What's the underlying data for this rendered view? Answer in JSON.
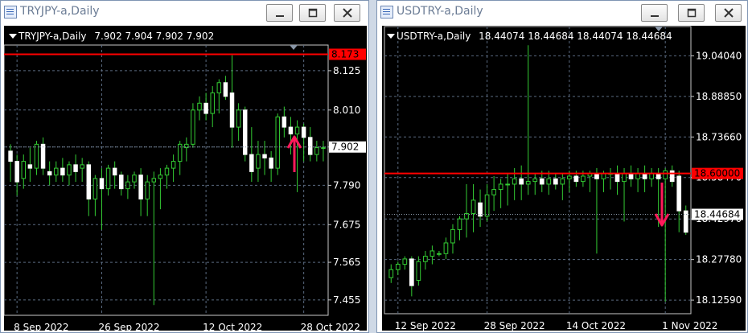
{
  "windows": [
    {
      "id": "left",
      "title": "TRYJPY-a,Daily",
      "header": {
        "symbol": "TRYJPY-a,Daily",
        "ohlc": "7.902 7.904 7.902 7.902"
      },
      "y_ticks": [
        "8.125",
        "8.010",
        "7.902",
        "7.790",
        "7.675",
        "7.565",
        "7.455"
      ],
      "y_tick_values": [
        8.125,
        8.01,
        7.902,
        7.79,
        7.675,
        7.565,
        7.455
      ],
      "x_ticks": [
        "8 Sep 2022",
        "26 Sep 2022",
        "12 Oct 2022",
        "28 Oct 2022"
      ],
      "h_line": {
        "label": "8.173",
        "value": 8.173,
        "color": "#ff0000"
      },
      "price_marker": {
        "label": "7.902",
        "value": 7.902
      },
      "arrow": {
        "direction": "up",
        "color": "#ff1a5a"
      }
    },
    {
      "id": "right",
      "title": "USDTRY-a,Daily",
      "header": {
        "symbol": "USDTRY-a,Daily",
        "ohlc": "18.44074 18.44684 18.44074 18.44684"
      },
      "y_ticks": [
        "19.04040",
        "18.88850",
        "18.73660",
        "18.58470",
        "18.42970",
        "18.27780",
        "18.12590"
      ],
      "y_tick_values": [
        19.0404,
        18.8885,
        18.7366,
        18.5847,
        18.4297,
        18.2778,
        18.1259
      ],
      "x_ticks": [
        "12 Sep 2022",
        "28 Sep 2022",
        "14 Oct 2022",
        "1 Nov 2022"
      ],
      "h_line": {
        "label": "18.60000",
        "value": 18.6,
        "color": "#ff0000"
      },
      "price_marker": {
        "label": "18.44684",
        "value": 18.44684
      },
      "arrow": {
        "direction": "down",
        "color": "#ff1a5a"
      }
    }
  ],
  "chart_data": [
    {
      "type": "candlestick",
      "title": "TRYJPY-a,Daily",
      "x": [
        "8 Sep 2022",
        "26 Sep 2022",
        "12 Oct 2022",
        "28 Oct 2022"
      ],
      "ylim": [
        7.41,
        8.2
      ],
      "candles": [
        [
          7.89,
          7.91,
          7.8,
          7.86
        ],
        [
          7.86,
          7.88,
          7.76,
          7.8
        ],
        [
          7.81,
          7.88,
          7.78,
          7.86
        ],
        [
          7.85,
          7.9,
          7.8,
          7.84
        ],
        [
          7.84,
          7.92,
          7.82,
          7.91
        ],
        [
          7.91,
          7.93,
          7.82,
          7.84
        ],
        [
          7.83,
          7.86,
          7.79,
          7.82
        ],
        [
          7.82,
          7.86,
          7.8,
          7.84
        ],
        [
          7.84,
          7.87,
          7.8,
          7.82
        ],
        [
          7.82,
          7.86,
          7.79,
          7.85
        ],
        [
          7.85,
          7.88,
          7.8,
          7.83
        ],
        [
          7.84,
          7.87,
          7.8,
          7.85
        ],
        [
          7.85,
          7.86,
          7.7,
          7.75
        ],
        [
          7.75,
          7.82,
          7.7,
          7.81
        ],
        [
          7.81,
          7.84,
          7.66,
          7.78
        ],
        [
          7.78,
          7.85,
          7.76,
          7.84
        ],
        [
          7.84,
          7.86,
          7.78,
          7.82
        ],
        [
          7.82,
          7.83,
          7.76,
          7.78
        ],
        [
          7.78,
          7.82,
          7.75,
          7.8
        ],
        [
          7.8,
          7.83,
          7.78,
          7.82
        ],
        [
          7.82,
          7.84,
          7.7,
          7.75
        ],
        [
          7.75,
          7.82,
          7.7,
          7.8
        ],
        [
          7.8,
          7.83,
          7.44,
          7.81
        ],
        [
          7.81,
          7.84,
          7.72,
          7.82
        ],
        [
          7.82,
          7.85,
          7.78,
          7.84
        ],
        [
          7.84,
          7.88,
          7.8,
          7.86
        ],
        [
          7.86,
          7.92,
          7.82,
          7.91
        ],
        [
          7.9,
          7.93,
          7.86,
          7.91
        ],
        [
          7.91,
          8.03,
          7.9,
          8.01
        ],
        [
          8.01,
          8.05,
          7.98,
          8.03
        ],
        [
          8.03,
          8.06,
          7.98,
          8.0
        ],
        [
          8.0,
          8.08,
          7.96,
          8.06
        ],
        [
          8.06,
          8.1,
          8.0,
          8.09
        ],
        [
          8.09,
          8.11,
          8.04,
          8.05
        ],
        [
          8.06,
          8.17,
          7.9,
          7.96
        ],
        [
          7.96,
          8.03,
          7.92,
          8.01
        ],
        [
          8.01,
          8.02,
          7.86,
          7.88
        ],
        [
          7.88,
          7.96,
          7.8,
          7.83
        ],
        [
          7.84,
          7.92,
          7.8,
          7.88
        ],
        [
          7.88,
          7.92,
          7.82,
          7.87
        ],
        [
          7.87,
          7.89,
          7.8,
          7.84
        ],
        [
          7.84,
          8.0,
          7.82,
          7.99
        ],
        [
          7.99,
          8.02,
          7.93,
          7.96
        ],
        [
          7.96,
          7.99,
          7.88,
          7.94
        ],
        [
          7.94,
          7.98,
          7.77,
          7.96
        ],
        [
          7.96,
          7.97,
          7.86,
          7.93
        ],
        [
          7.93,
          7.96,
          7.86,
          7.88
        ],
        [
          7.88,
          7.92,
          7.86,
          7.9
        ],
        [
          7.9,
          7.92,
          7.86,
          7.9
        ]
      ]
    },
    {
      "type": "candlestick",
      "title": "USDTRY-a,Daily",
      "x": [
        "12 Sep 2022",
        "28 Sep 2022",
        "14 Oct 2022",
        "1 Nov 2022"
      ],
      "ylim": [
        18.075,
        19.15
      ],
      "candles": [
        [
          18.21,
          18.26,
          18.19,
          18.24
        ],
        [
          18.24,
          18.27,
          18.22,
          18.26
        ],
        [
          18.26,
          18.29,
          18.24,
          18.28
        ],
        [
          18.28,
          18.29,
          18.14,
          18.18
        ],
        [
          18.2,
          18.29,
          18.18,
          18.27
        ],
        [
          18.27,
          18.31,
          18.24,
          18.29
        ],
        [
          18.29,
          18.33,
          18.26,
          18.31
        ],
        [
          18.3,
          18.31,
          18.29,
          18.3
        ],
        [
          18.3,
          18.36,
          18.28,
          18.34
        ],
        [
          18.34,
          18.41,
          18.3,
          18.39
        ],
        [
          18.39,
          18.44,
          18.35,
          18.43
        ],
        [
          18.43,
          18.56,
          18.36,
          18.45
        ],
        [
          18.45,
          18.56,
          18.38,
          18.5
        ],
        [
          18.49,
          18.54,
          18.4,
          18.44
        ],
        [
          18.44,
          18.56,
          18.42,
          18.52
        ],
        [
          18.52,
          18.59,
          18.46,
          18.54
        ],
        [
          18.54,
          18.58,
          18.47,
          18.56
        ],
        [
          18.56,
          18.6,
          18.48,
          18.56
        ],
        [
          18.56,
          18.62,
          18.5,
          18.58
        ],
        [
          18.58,
          18.63,
          18.5,
          18.56
        ],
        [
          18.56,
          19.08,
          18.52,
          18.57
        ],
        [
          18.57,
          18.6,
          18.52,
          18.58
        ],
        [
          18.58,
          18.61,
          18.53,
          18.56
        ],
        [
          18.56,
          18.61,
          18.52,
          18.58
        ],
        [
          18.58,
          18.6,
          18.54,
          18.56
        ],
        [
          18.56,
          18.6,
          18.5,
          18.58
        ],
        [
          18.58,
          18.61,
          18.53,
          18.59
        ],
        [
          18.59,
          18.61,
          18.55,
          18.57
        ],
        [
          18.57,
          18.61,
          18.55,
          18.59
        ],
        [
          18.59,
          18.61,
          18.53,
          18.6
        ],
        [
          18.6,
          18.62,
          18.3,
          18.58
        ],
        [
          18.58,
          18.61,
          18.53,
          18.6
        ],
        [
          18.6,
          18.62,
          18.54,
          18.6
        ],
        [
          18.6,
          18.63,
          18.52,
          18.57
        ],
        [
          18.57,
          18.62,
          18.42,
          18.6
        ],
        [
          18.6,
          18.63,
          18.55,
          18.58
        ],
        [
          18.58,
          18.62,
          18.53,
          18.6
        ],
        [
          18.6,
          18.63,
          18.53,
          18.58
        ],
        [
          18.58,
          18.62,
          18.55,
          18.6
        ],
        [
          18.6,
          18.62,
          18.4,
          18.58
        ],
        [
          18.58,
          18.62,
          18.12,
          18.61
        ],
        [
          18.61,
          18.63,
          18.55,
          18.57
        ],
        [
          18.59,
          18.61,
          18.38,
          18.46
        ],
        [
          18.46,
          18.48,
          18.37,
          18.38
        ]
      ]
    }
  ]
}
